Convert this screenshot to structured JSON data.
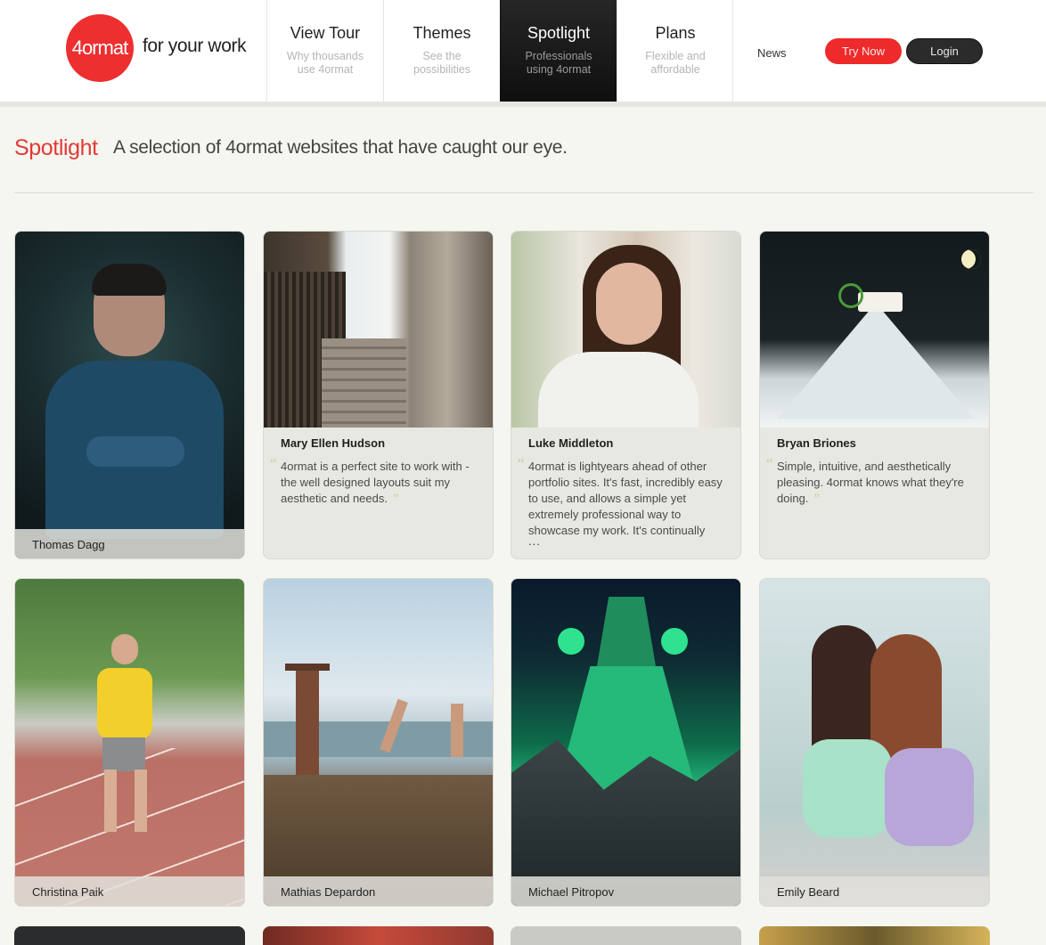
{
  "brand": {
    "logo_text": "4ormat",
    "tagline": "for your work",
    "accent": "#ed2f2f"
  },
  "nav": [
    {
      "title": "View Tour",
      "subtitle": "Why thousands use 4ormat"
    },
    {
      "title": "Themes",
      "subtitle": "See the possibilities"
    },
    {
      "title": "Spotlight",
      "subtitle": "Professionals using 4ormat",
      "active": true
    },
    {
      "title": "Plans",
      "subtitle": "Flexible and affordable"
    }
  ],
  "header": {
    "news": "News",
    "try_now": "Try Now",
    "login": "Login"
  },
  "page": {
    "title": "Spotlight",
    "subtitle": "A selection of 4ormat websites that have caught our eye."
  },
  "cards": {
    "thomas": {
      "name": "Thomas Dagg"
    },
    "mary": {
      "name": "Mary Ellen Hudson",
      "quote": "4ormat is a perfect site to work with - the well designed layouts suit my aesthetic and needs."
    },
    "luke": {
      "name": "Luke Middleton",
      "quote": "4ormat is lightyears ahead of other portfolio sites. It's fast, incredibly easy to use, and allows a simple yet extremely professional way to showcase my work. It's continually",
      "more": "..."
    },
    "bryan": {
      "name": "Bryan Briones",
      "quote": "Simple, intuitive, and aesthetically pleasing. 4ormat knows what they're doing."
    },
    "christina": {
      "name": "Christina Paik"
    },
    "mathias": {
      "name": "Mathias Depardon"
    },
    "michael": {
      "name": "Michael Pitropov"
    },
    "emily": {
      "name": "Emily Beard"
    }
  },
  "quote_marks": {
    "open": "“",
    "close": "”"
  }
}
